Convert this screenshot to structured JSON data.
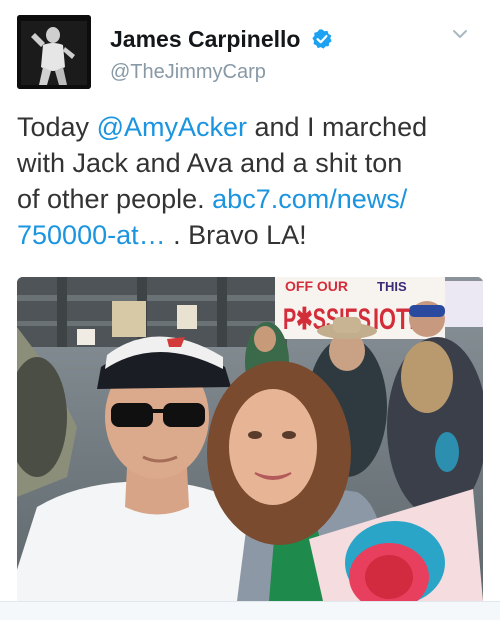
{
  "tweet": {
    "display_name": "James Carpinello",
    "handle": "@TheJimmyCarp",
    "verified_icon": "verified-badge-icon",
    "more_icon": "chevron-down-icon",
    "text": {
      "l1_a": "Today ",
      "l1_mention": "@AmyAcker",
      "l1_b": " and I marched",
      "l2": "with Jack and Ava and a shit ton",
      "l3_a": "of other people. ",
      "l3_link": "abc7.com/news/",
      "l4_link": "750000-at…",
      "l4_b": " . Bravo LA!"
    }
  },
  "photo": {
    "sign_top_a": "OFF OUR",
    "sign_top_b": "THIS",
    "sign_main": "P✱SSIES",
    "sign_main_b": "IOTIC"
  },
  "colors": {
    "link": "#1b95e0",
    "verified": "#1da1f2",
    "text": "#333333",
    "handle": "#8899a6"
  }
}
